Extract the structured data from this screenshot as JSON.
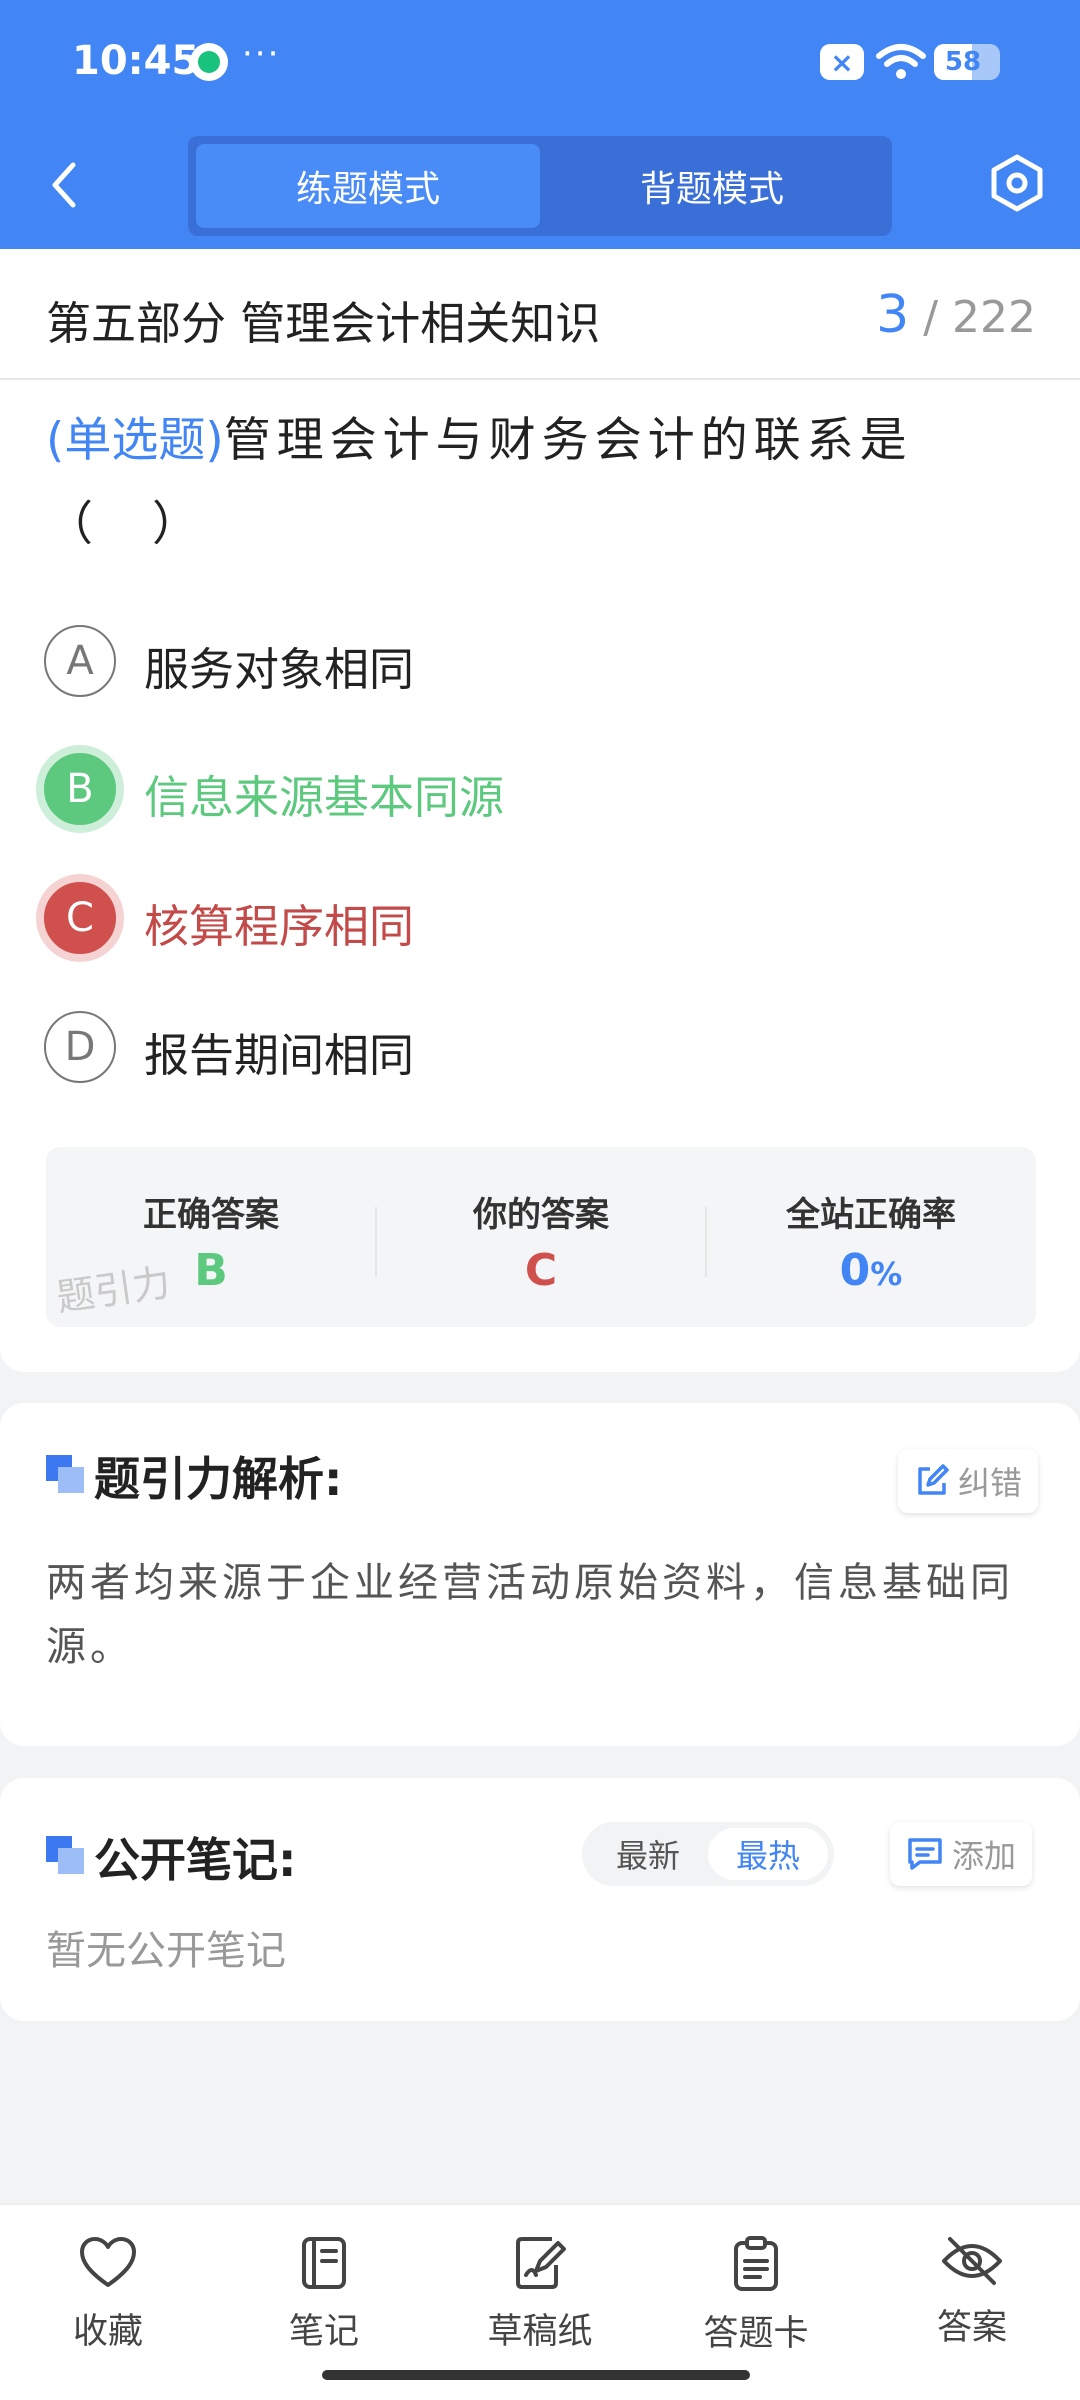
{
  "status_bar": {
    "time": "10:45",
    "more": "···",
    "battery": "58",
    "battery_level": 0.58
  },
  "header": {
    "tabs": [
      {
        "label": "练题模式",
        "active": true
      },
      {
        "label": "背题模式",
        "active": false
      }
    ]
  },
  "question": {
    "section": "第五部分 管理会计相关知识",
    "current": "3",
    "total": "/ 222",
    "type": "(单选题)",
    "text": "管理会计与财务会计的联系是（　）",
    "options": [
      {
        "letter": "A",
        "text": "服务对象相同",
        "state": "normal"
      },
      {
        "letter": "B",
        "text": "信息来源基本同源",
        "state": "correct"
      },
      {
        "letter": "C",
        "text": "核算程序相同",
        "state": "wrong"
      },
      {
        "letter": "D",
        "text": "报告期间相同",
        "state": "normal"
      }
    ]
  },
  "answer_summary": {
    "correct_label": "正确答案",
    "correct_value": "B",
    "yours_label": "你的答案",
    "yours_value": "C",
    "rate_label": "全站正确率",
    "rate_value": "0",
    "rate_unit": "%",
    "watermark": "题引力"
  },
  "analysis": {
    "title": "题引力解析:",
    "report_label": "纠错",
    "text": "两者均来源于企业经营活动原始资料，信息基础同源。"
  },
  "notes": {
    "title": "公开笔记:",
    "sort_latest": "最新",
    "sort_hot": "最热",
    "add_label": "添加",
    "empty": "暂无公开笔记"
  },
  "bottom_nav": [
    {
      "label": "收藏",
      "icon": "heart-icon"
    },
    {
      "label": "笔记",
      "icon": "notebook-icon"
    },
    {
      "label": "草稿纸",
      "icon": "draft-paper-icon"
    },
    {
      "label": "答题卡",
      "icon": "answer-sheet-icon"
    },
    {
      "label": "答案",
      "icon": "eye-off-icon"
    }
  ],
  "colors": {
    "primary": "#4285f4",
    "correct": "#5cc97f",
    "wrong": "#d0504e"
  }
}
